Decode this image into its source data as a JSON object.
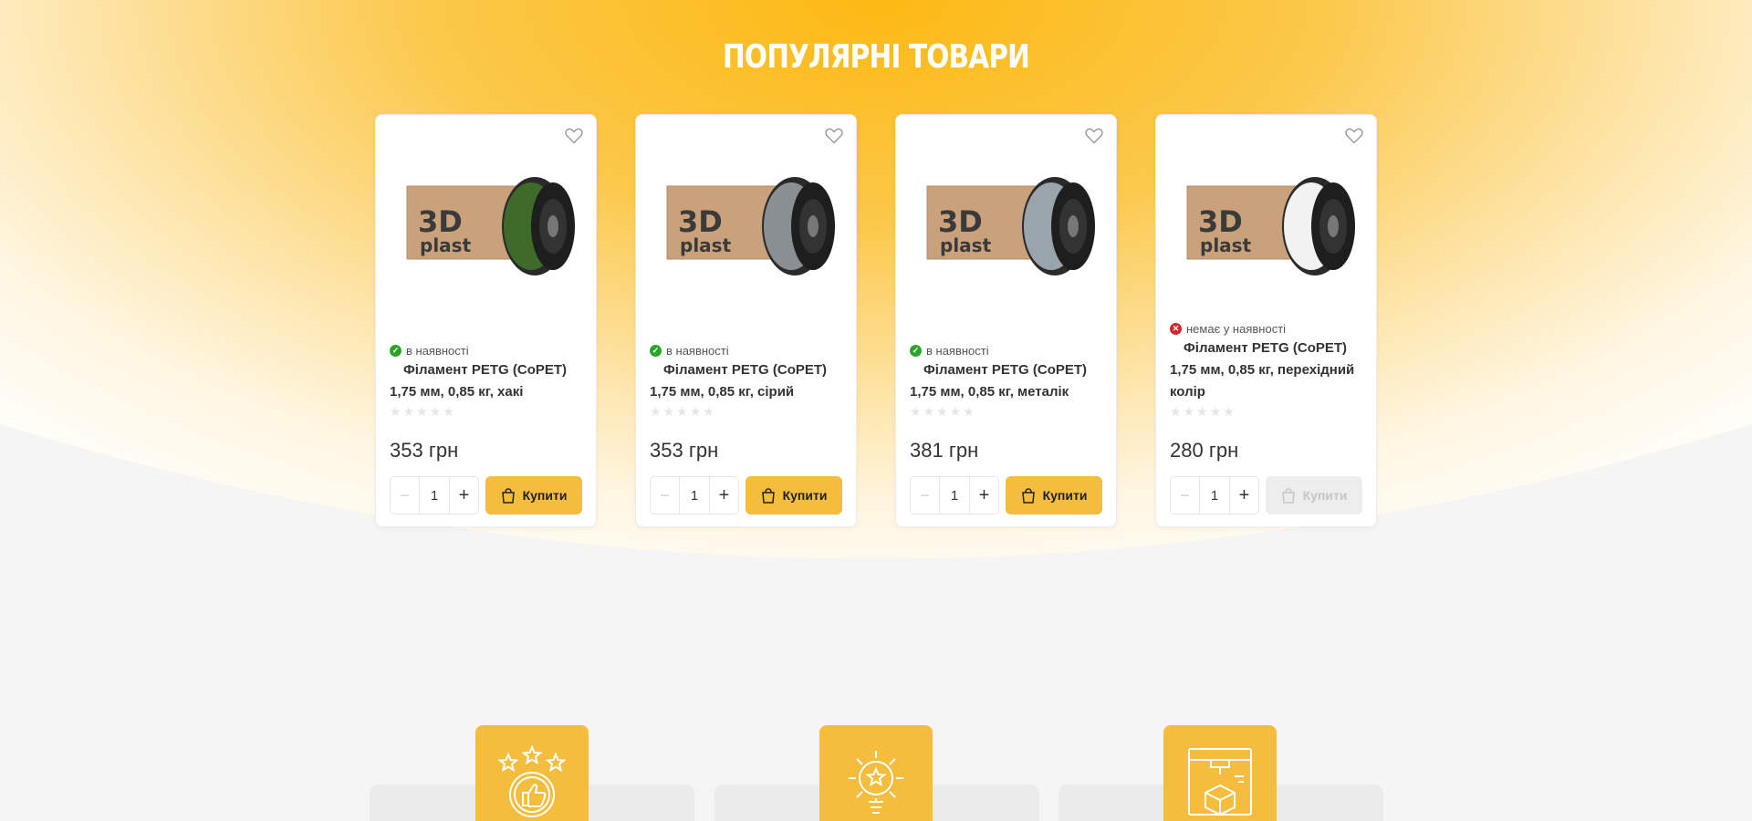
{
  "section": {
    "title": "ПОПУЛЯРНІ ТОВАРИ"
  },
  "colors": {
    "accent": "#f4bd3e",
    "in_stock": "#2aa52a",
    "out_of_stock": "#d9262b",
    "hero_top": "#fdb913"
  },
  "products": [
    {
      "stock": "в наявності",
      "in_stock": true,
      "name": "Філамент PETG (CoPET) 1,75 мм, 0,85 кг, хакі",
      "spool_color": "#3f6b2a",
      "rating": 0,
      "price": "353 грн",
      "qty": "1",
      "buy_label": "Купити"
    },
    {
      "stock": "в наявності",
      "in_stock": true,
      "name": "Філамент PETG (CoPET) 1,75 мм, 0,85 кг, сірий",
      "spool_color": "#8a8f94",
      "rating": 0,
      "price": "353 грн",
      "qty": "1",
      "buy_label": "Купити"
    },
    {
      "stock": "в наявності",
      "in_stock": true,
      "name": "Філамент PETG (CoPET) 1,75 мм, 0,85 кг, металік",
      "spool_color": "#9aa4ad",
      "rating": 0,
      "price": "381 грн",
      "qty": "1",
      "buy_label": "Купити"
    },
    {
      "stock": "немає у наявності",
      "in_stock": false,
      "name": "Філамент PETG (CoPET) 1,75 мм, 0,85 кг, перехідний колір",
      "spool_color": "#f2f2f2",
      "rating": 0,
      "price": "280 грн",
      "qty": "1",
      "buy_label": "Купити"
    }
  ],
  "product_image": {
    "box_text_1": "3D",
    "box_text_2": "plast"
  },
  "features": [
    {
      "icon": "stars-thumbs-up-icon"
    },
    {
      "icon": "gear-star-bulb-icon"
    },
    {
      "icon": "3d-printer-cube-icon"
    }
  ]
}
